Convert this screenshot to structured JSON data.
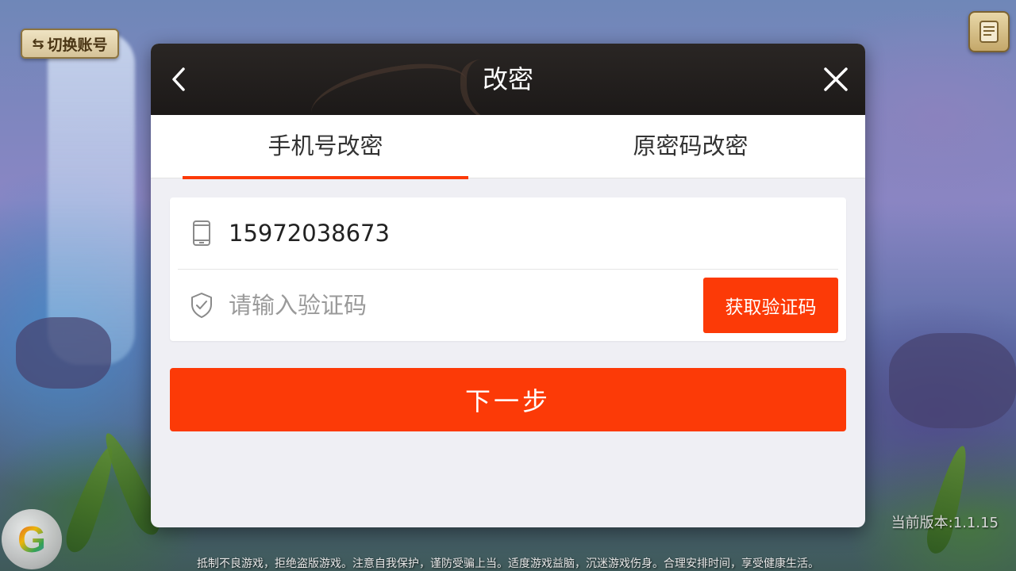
{
  "background": {
    "switch_account_label": "切换账号",
    "version_text": "当前版本:1.1.15",
    "disclaimer": "抵制不良游戏，拒绝盗版游戏。注意自我保护，谨防受骗上当。适度游戏益脑，沉迷游戏伤身。合理安排时间，享受健康生活。",
    "float_ball_letter": "G"
  },
  "dialog": {
    "title": "改密",
    "tabs": [
      {
        "label": "手机号改密",
        "active": true
      },
      {
        "label": "原密码改密",
        "active": false
      }
    ],
    "form": {
      "phone_value": "15972038673",
      "code_placeholder": "请输入验证码",
      "get_code_label": "获取验证码"
    },
    "next_label": "下一步"
  },
  "colors": {
    "accent": "#fc3a07",
    "header_bg": "#1c1918",
    "dialog_bg": "#efeff4"
  }
}
